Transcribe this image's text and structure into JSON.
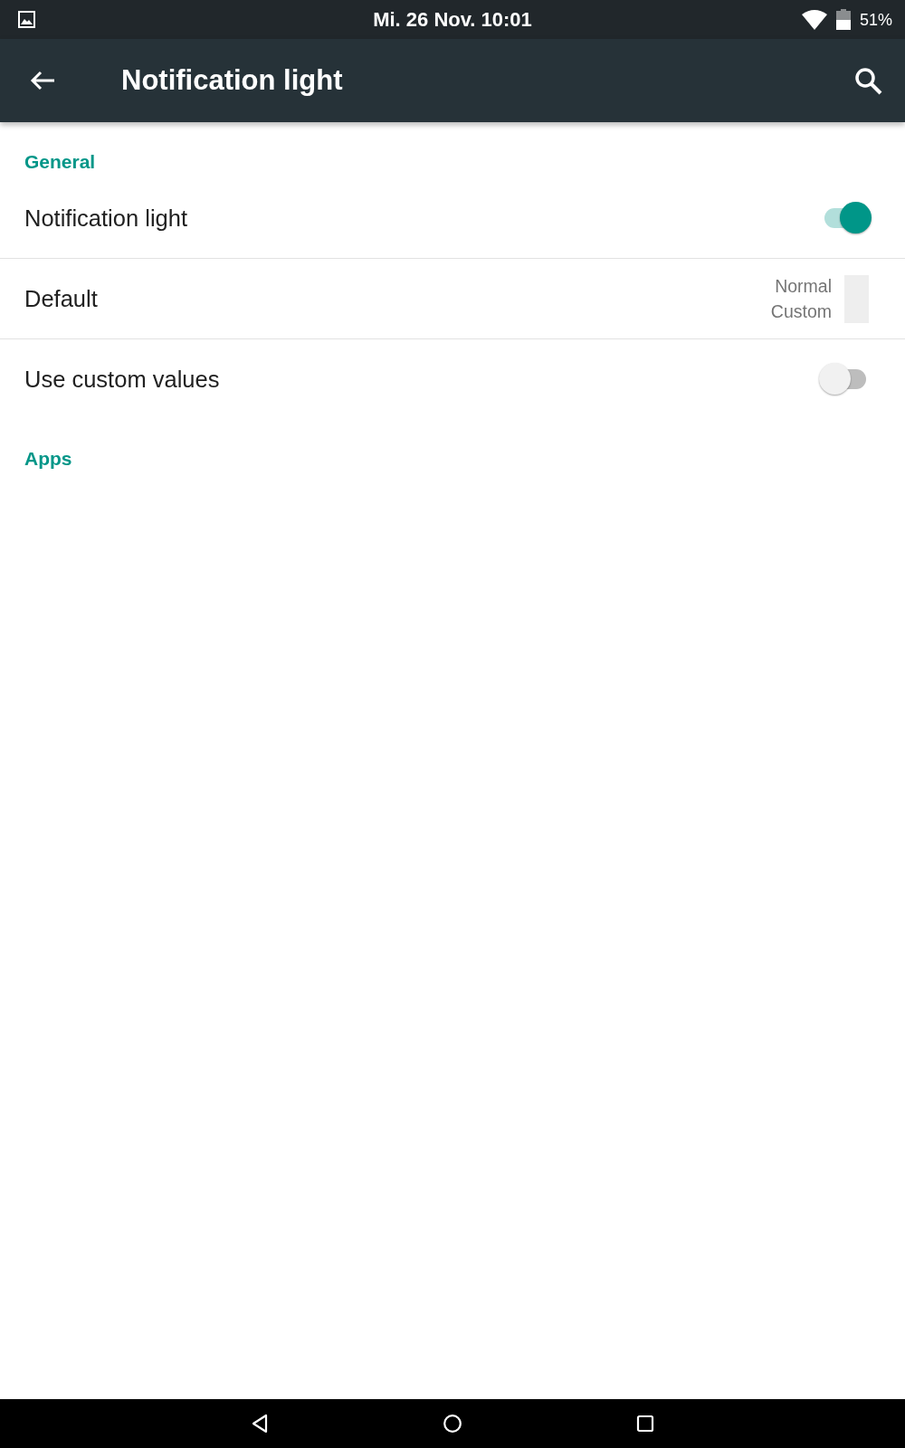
{
  "status_bar": {
    "time": "Mi. 26 Nov. 10:01",
    "battery": "51%"
  },
  "app_bar": {
    "title": "Notification light"
  },
  "sections": [
    {
      "title": "General",
      "items": [
        {
          "kind": "switch",
          "label": "Notification light",
          "on": true
        },
        {
          "kind": "light",
          "label": "Default",
          "summary": [
            "Normal",
            "Custom"
          ],
          "color": "#eeeeee"
        },
        {
          "kind": "switch",
          "label": "Use custom values",
          "on": false
        }
      ]
    },
    {
      "title": "Apps"
    }
  ]
}
